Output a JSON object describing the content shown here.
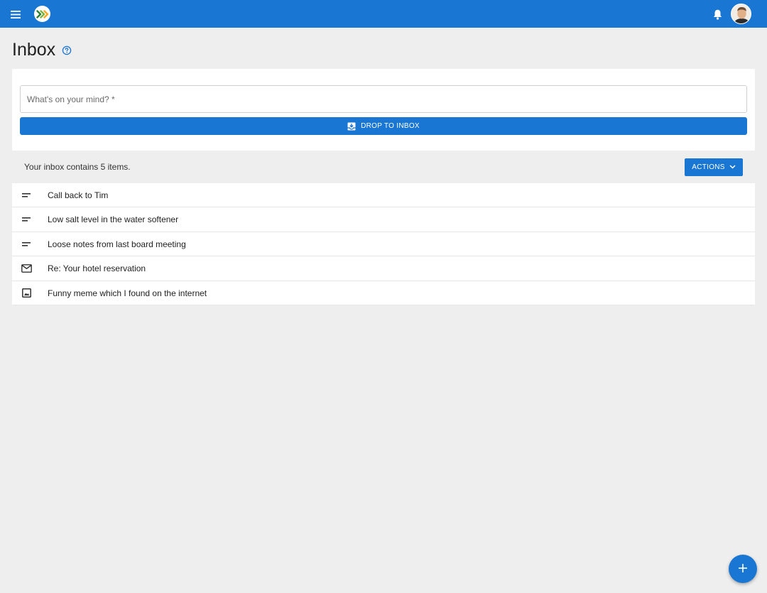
{
  "colors": {
    "primary": "#1976d2",
    "background": "#eeeeee",
    "surface": "#ffffff"
  },
  "appbar": {
    "menu_icon": "menu-icon",
    "logo_icon": "app-logo-icon",
    "notifications_icon": "bell-icon",
    "avatar_icon": "user-avatar"
  },
  "page": {
    "title": "Inbox",
    "help_icon": "help-circle-icon"
  },
  "capture": {
    "placeholder": "What's on your mind? *",
    "value": "",
    "drop_button_label": "DROP TO INBOX",
    "drop_button_icon": "move-to-inbox-icon"
  },
  "summary": {
    "text": "Your inbox contains 5 items.",
    "actions_label": "ACTIONS",
    "actions_icon": "chevron-down-icon"
  },
  "inbox": {
    "items": [
      {
        "label": "Call back to Tim",
        "icon": "short-text-icon"
      },
      {
        "label": "Low salt level in the water softener",
        "icon": "short-text-icon"
      },
      {
        "label": "Loose notes from last board meeting",
        "icon": "short-text-icon"
      },
      {
        "label": "Re: Your hotel reservation",
        "icon": "mail-icon"
      },
      {
        "label": "Funny meme which I found on the internet",
        "icon": "image-icon"
      }
    ]
  },
  "fab": {
    "icon": "plus-icon"
  }
}
